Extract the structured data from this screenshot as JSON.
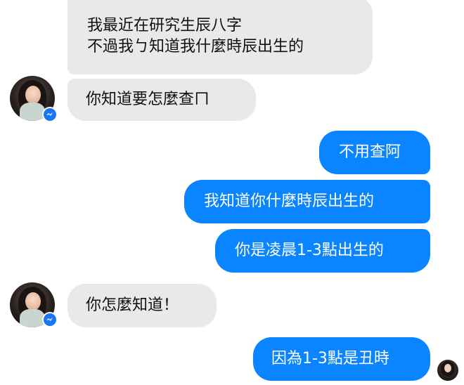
{
  "messages": [
    {
      "side": "incoming",
      "lines": [
        "我最近在研究生辰八字",
        "不過我ㄅ知道我什麼時辰出生的"
      ]
    },
    {
      "side": "incoming",
      "lines": [
        "你知道要怎麼查ㄇ"
      ]
    },
    {
      "side": "outgoing",
      "lines": [
        "不用查阿"
      ]
    },
    {
      "side": "outgoing",
      "lines": [
        "我知道你什麼時辰出生的"
      ]
    },
    {
      "side": "outgoing",
      "lines": [
        "你是凌晨1-3點出生的"
      ]
    },
    {
      "side": "incoming",
      "lines": [
        "你怎麼知道！"
      ]
    },
    {
      "side": "outgoing",
      "lines": [
        "因為1-3點是丑時"
      ]
    }
  ],
  "icons": {
    "contact_avatar": "contact-avatar-icon",
    "messenger_badge": "messenger-badge-icon",
    "read_receipt": "read-receipt-avatar-icon"
  },
  "colors": {
    "incoming_bubble": "#e9e9eb",
    "outgoing_bubble": "#0a84ff",
    "badge": "#1877f2"
  }
}
